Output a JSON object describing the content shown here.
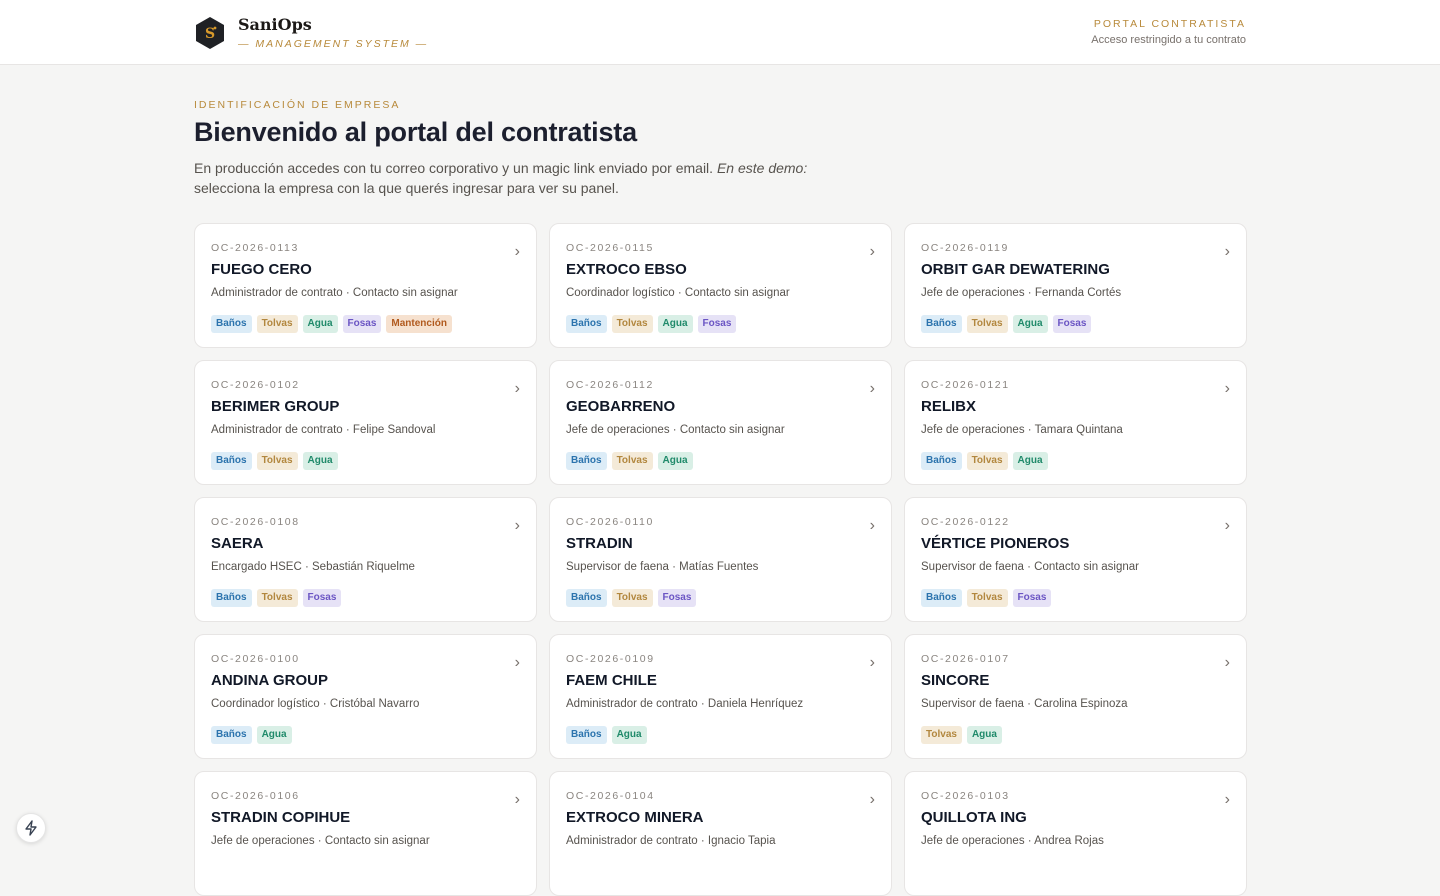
{
  "brand": {
    "name": "SaniOps",
    "subtitle": "— MANAGEMENT SYSTEM —",
    "accent": "#b88a3b"
  },
  "portal": {
    "title": "PORTAL CONTRATISTA",
    "subtitle": "Acceso restringido a tu contrato"
  },
  "page": {
    "eyebrow": "IDENTIFICACIÓN DE EMPRESA",
    "title": "Bienvenido al portal del contratista",
    "intro_text": "En producción accedes con tu correo corporativo y un magic link enviado por email. ",
    "intro_em": "En este demo:",
    "intro_rest": " selecciona la empresa con la que querés ingresar para ver su panel."
  },
  "tag_colors": {
    "Baños": "#2b73ad",
    "Tolvas": "#b2873e",
    "Agua": "#1f8a6a",
    "Fosas": "#6b55c4",
    "Mantención": "#b15a1e"
  },
  "companies": [
    {
      "code": "OC-2026-0113",
      "name": "FUEGO CERO",
      "role": "Administrador de contrato",
      "contact": "Contacto sin asignar",
      "tags": [
        "Baños",
        "Tolvas",
        "Agua",
        "Fosas",
        "Mantención"
      ]
    },
    {
      "code": "OC-2026-0115",
      "name": "EXTROCO EBSO",
      "role": "Coordinador logístico",
      "contact": "Contacto sin asignar",
      "tags": [
        "Baños",
        "Tolvas",
        "Agua",
        "Fosas"
      ]
    },
    {
      "code": "OC-2026-0119",
      "name": "ORBIT GAR DEWATERING",
      "role": "Jefe de operaciones",
      "contact": "Fernanda Cortés",
      "tags": [
        "Baños",
        "Tolvas",
        "Agua",
        "Fosas"
      ]
    },
    {
      "code": "OC-2026-0102",
      "name": "BERIMER GROUP",
      "role": "Administrador de contrato",
      "contact": "Felipe Sandoval",
      "tags": [
        "Baños",
        "Tolvas",
        "Agua"
      ]
    },
    {
      "code": "OC-2026-0112",
      "name": "GEOBARRENO",
      "role": "Jefe de operaciones",
      "contact": "Contacto sin asignar",
      "tags": [
        "Baños",
        "Tolvas",
        "Agua"
      ]
    },
    {
      "code": "OC-2026-0121",
      "name": "RELIBX",
      "role": "Jefe de operaciones",
      "contact": "Tamara Quintana",
      "tags": [
        "Baños",
        "Tolvas",
        "Agua"
      ]
    },
    {
      "code": "OC-2026-0108",
      "name": "SAERA",
      "role": "Encargado HSEC",
      "contact": "Sebastián Riquelme",
      "tags": [
        "Baños",
        "Tolvas",
        "Fosas"
      ]
    },
    {
      "code": "OC-2026-0110",
      "name": "STRADIN",
      "role": "Supervisor de faena",
      "contact": "Matías Fuentes",
      "tags": [
        "Baños",
        "Tolvas",
        "Fosas"
      ]
    },
    {
      "code": "OC-2026-0122",
      "name": "VÉRTICE PIONEROS",
      "role": "Supervisor de faena",
      "contact": "Contacto sin asignar",
      "tags": [
        "Baños",
        "Tolvas",
        "Fosas"
      ]
    },
    {
      "code": "OC-2026-0100",
      "name": "ANDINA GROUP",
      "role": "Coordinador logístico",
      "contact": "Cristóbal Navarro",
      "tags": [
        "Baños",
        "Agua"
      ]
    },
    {
      "code": "OC-2026-0109",
      "name": "FAEM CHILE",
      "role": "Administrador de contrato",
      "contact": "Daniela Henríquez",
      "tags": [
        "Baños",
        "Agua"
      ]
    },
    {
      "code": "OC-2026-0107",
      "name": "SINCORE",
      "role": "Supervisor de faena",
      "contact": "Carolina Espinoza",
      "tags": [
        "Tolvas",
        "Agua"
      ]
    },
    {
      "code": "OC-2026-0106",
      "name": "STRADIN COPIHUE",
      "role": "Jefe de operaciones",
      "contact": "Contacto sin asignar",
      "tags": []
    },
    {
      "code": "OC-2026-0104",
      "name": "EXTROCO MINERA",
      "role": "Administrador de contrato",
      "contact": "Ignacio Tapia",
      "tags": []
    },
    {
      "code": "OC-2026-0103",
      "name": "QUILLOTA ING",
      "role": "Jefe de operaciones",
      "contact": "Andrea Rojas",
      "tags": []
    }
  ]
}
